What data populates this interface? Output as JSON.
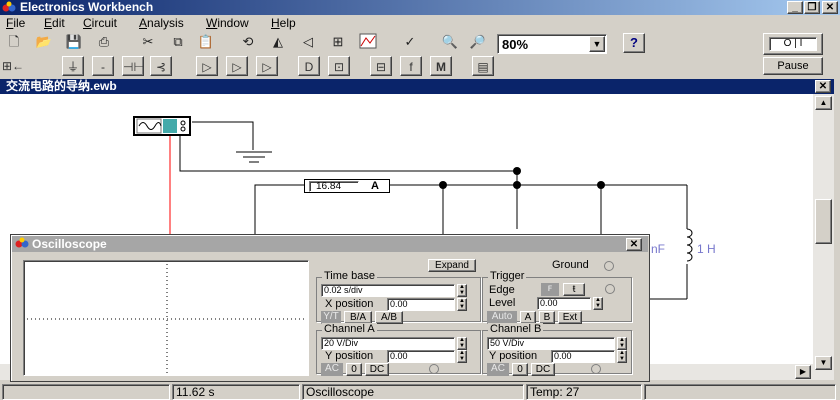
{
  "app": {
    "title": "Electronics Workbench"
  },
  "menu": [
    {
      "key": "F",
      "rest": "ile"
    },
    {
      "key": "E",
      "rest": "dit"
    },
    {
      "key": "C",
      "rest": "ircuit"
    },
    {
      "key": "A",
      "rest": "nalysis"
    },
    {
      "key": "W",
      "rest": "indow"
    },
    {
      "key": "H",
      "rest": "elp"
    }
  ],
  "toolbar": {
    "zoom": "80%",
    "help_label": "?",
    "pause_label": "Pause",
    "power_label": "O | I"
  },
  "document": {
    "title": "交流电路的导纳.ewb"
  },
  "circuit": {
    "ammeter_value": "16.84",
    "ammeter_unit": "A",
    "inductor_label": "1 H",
    "capacitor_fragment": "nF"
  },
  "oscilloscope": {
    "title": "Oscilloscope",
    "expand_label": "Expand",
    "ground_label": "Ground",
    "timebase": {
      "label": "Time base",
      "value": "0.02 s/div",
      "xpos_label": "X position",
      "xpos_value": "0.00",
      "modes": [
        "Y/T",
        "B/A",
        "A/B"
      ]
    },
    "trigger": {
      "label": "Trigger",
      "edge_label": "Edge",
      "level_label": "Level",
      "level_value": "0.00",
      "sources": [
        "Auto",
        "A",
        "B",
        "Ext"
      ]
    },
    "channel_a": {
      "label": "Channel A",
      "value": "20 V/Div",
      "ypos_label": "Y position",
      "ypos_value": "0.00",
      "coupling": [
        "AC",
        "0",
        "DC"
      ]
    },
    "channel_b": {
      "label": "Channel B",
      "value": "50 V/Div",
      "ypos_label": "Y position",
      "ypos_value": "0.00",
      "coupling": [
        "AC",
        "0",
        "DC"
      ]
    }
  },
  "status": {
    "time": "11.62 s",
    "component": "Oscilloscope",
    "temp": "Temp:  27"
  },
  "colors": {
    "title_active": "#0a246a",
    "title_inactive": "#a6a6a6",
    "wire_red": "#ff0000",
    "component_blue": "#5555cc"
  }
}
